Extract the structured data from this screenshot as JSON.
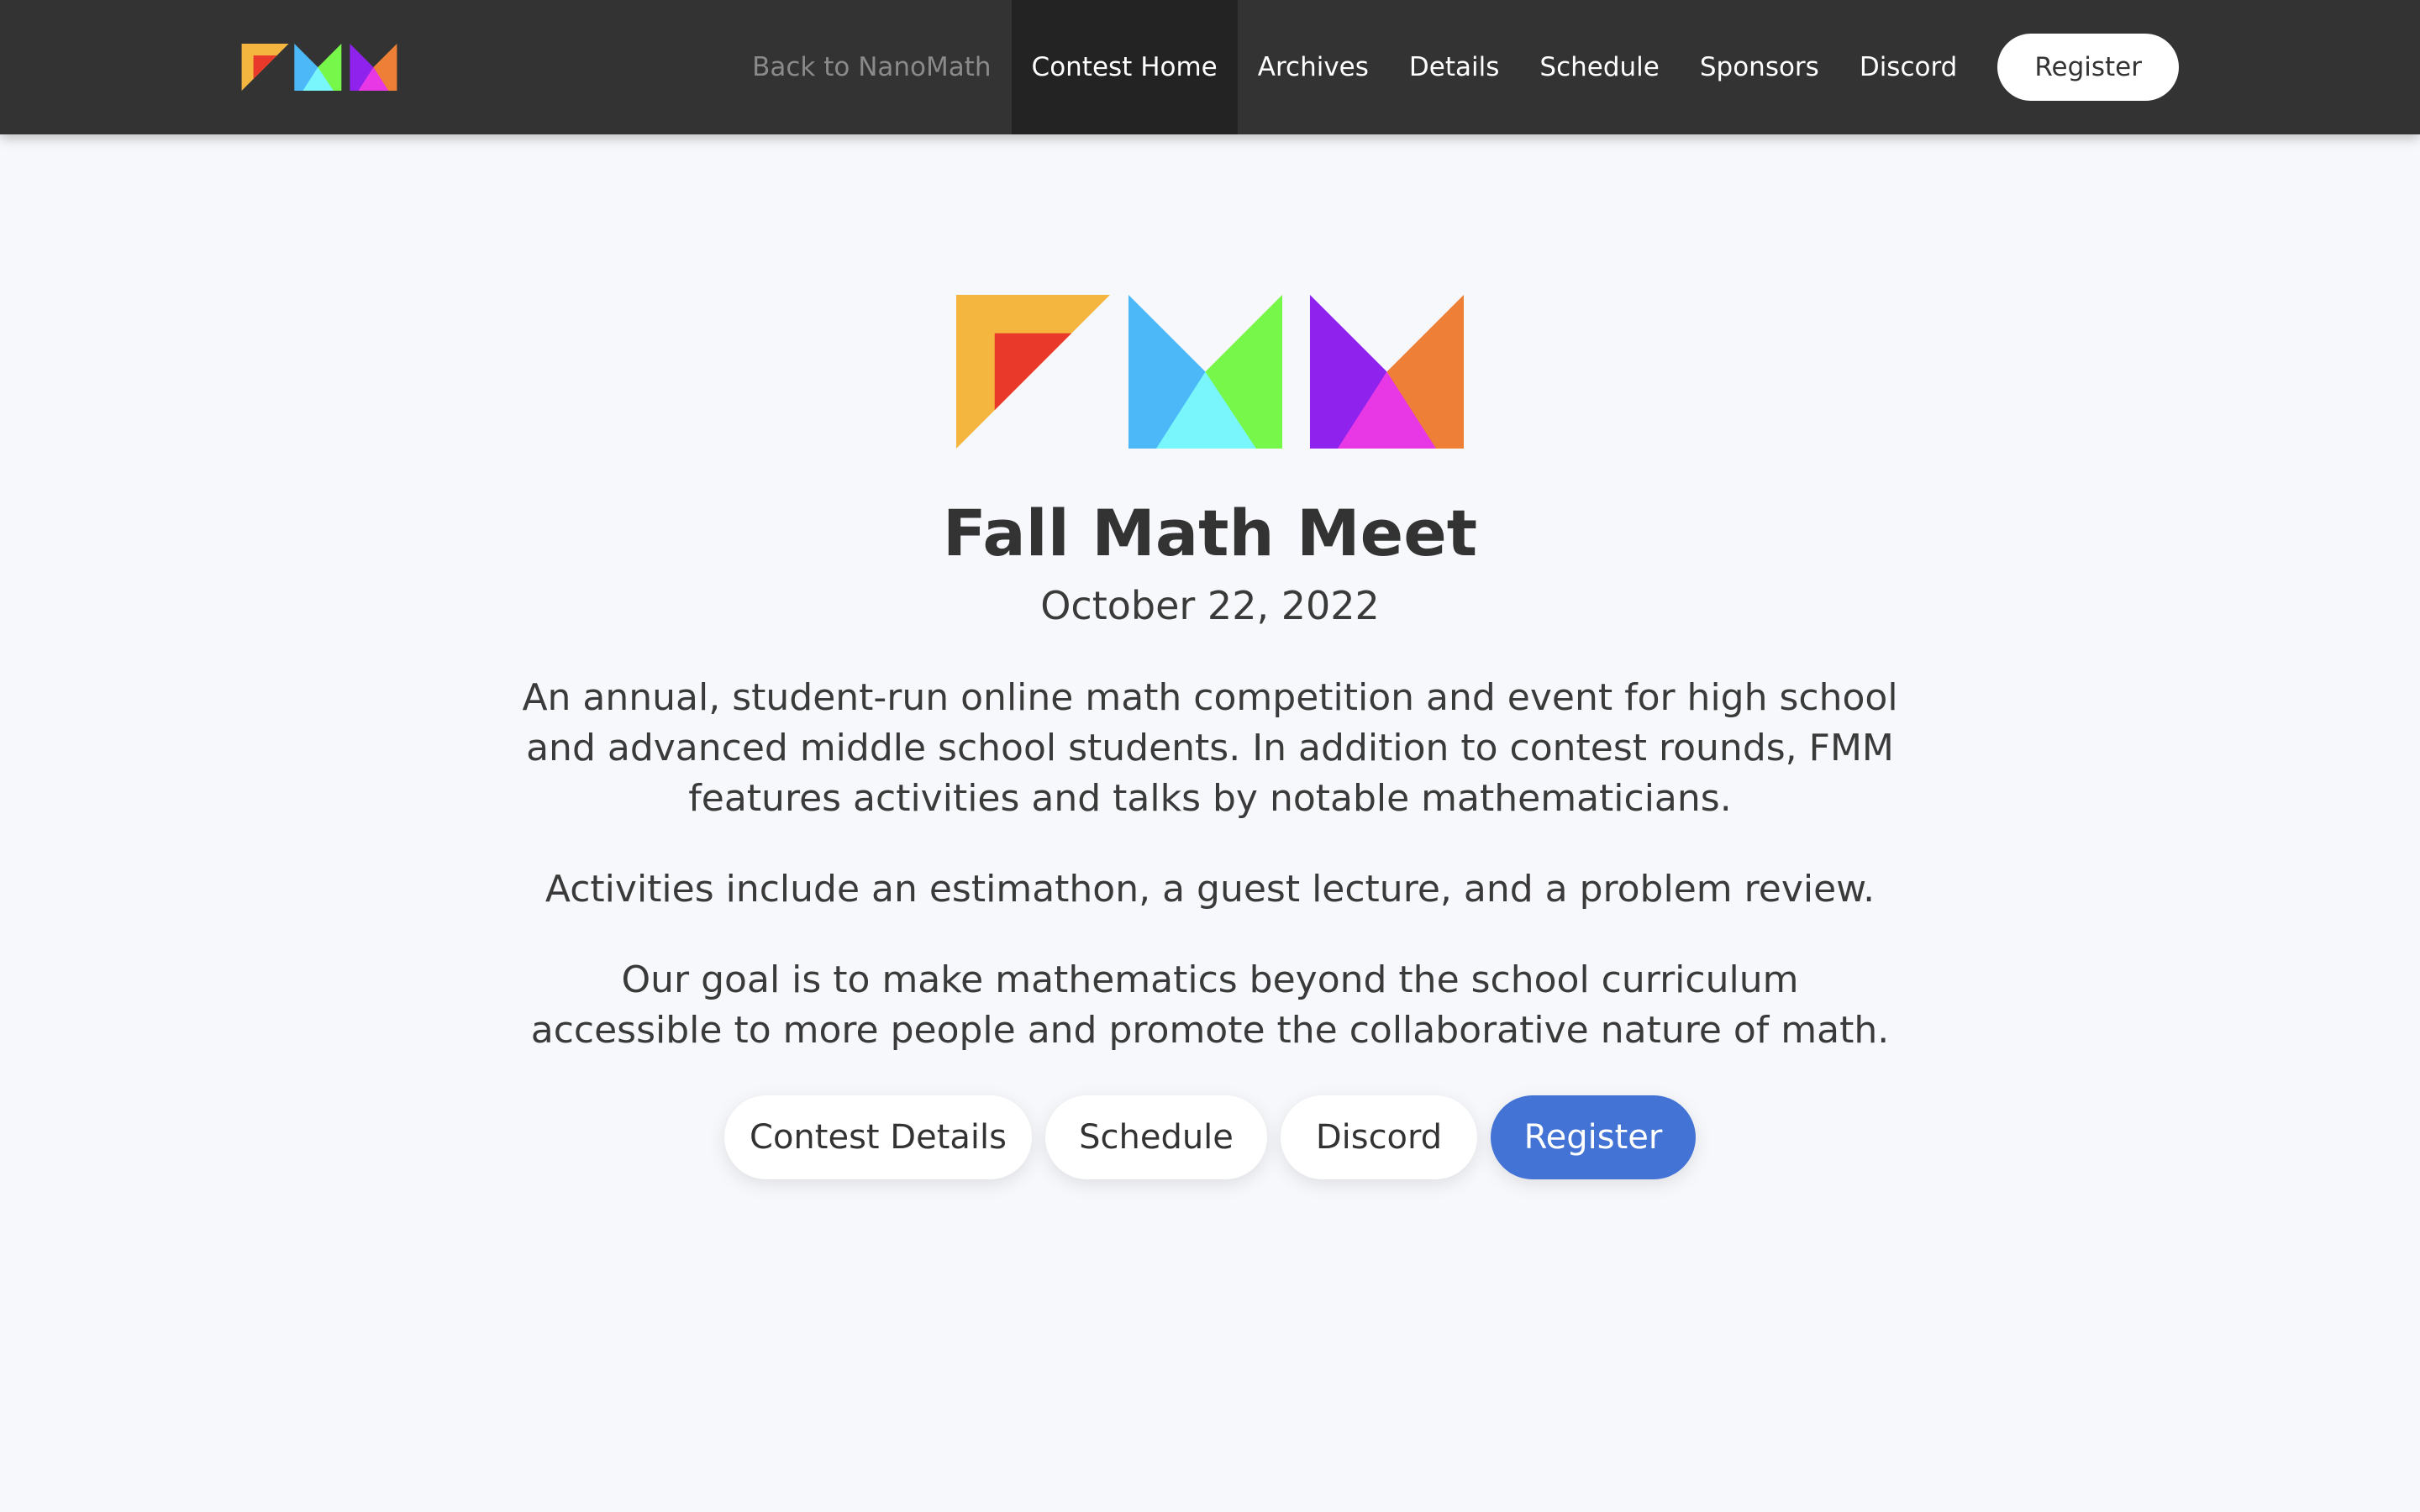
{
  "nav": {
    "logo_text": "FMM",
    "links": [
      {
        "label": "Back to NanoMath"
      },
      {
        "label": "Contest Home"
      },
      {
        "label": "Archives"
      },
      {
        "label": "Details"
      },
      {
        "label": "Schedule"
      },
      {
        "label": "Sponsors"
      },
      {
        "label": "Discord"
      }
    ],
    "active_link": "Contest Home",
    "register_label": "Register"
  },
  "hero": {
    "logo_text": "FMM",
    "title": "Fall Math Meet",
    "date": "October 22, 2022",
    "paragraph1_lines": [
      "An annual, student-run online math competition and event for high school",
      "and advanced middle school students. In addition to contest rounds, FMM",
      "features activities and talks by notable mathematicians."
    ],
    "paragraph2": "Activities include an estimathon, a guest lecture, and a problem review.",
    "paragraph3_lines": [
      "Our goal is to make mathematics beyond the school curriculum",
      "accessible to more people and promote the collaborative nature of math."
    ],
    "buttons": [
      {
        "label": "Contest Details"
      },
      {
        "label": "Schedule"
      },
      {
        "label": "Discord"
      },
      {
        "label": "Register"
      }
    ]
  },
  "colors": {
    "navbar_bg": "#333333",
    "page_bg": "#f7f8fb",
    "primary_button": "#4273d5",
    "logo_yellow": "#f4b63f",
    "logo_red": "#e8392b",
    "logo_blue": "#4db8f7",
    "logo_green": "#77f74a",
    "logo_cyan": "#78f6fb",
    "logo_purple": "#9022ee",
    "logo_orange": "#ee7f36",
    "logo_magenta": "#e838e6"
  },
  "icons": {
    "nav_logo": "fmm-logo-icon",
    "hero_logo": "fmm-logo-icon"
  }
}
